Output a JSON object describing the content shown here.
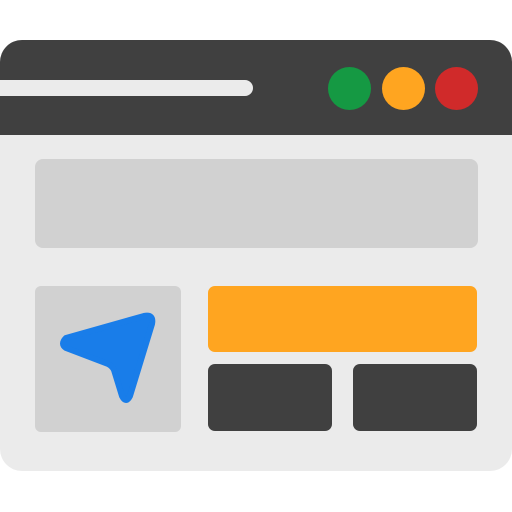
{
  "window": {
    "controls": [
      {
        "name": "green",
        "color": "#159943"
      },
      {
        "name": "orange",
        "color": "#ffa520"
      },
      {
        "name": "red",
        "color": "#d02a2a"
      }
    ]
  },
  "icons": {
    "cursor": "navigation-arrow-icon"
  },
  "colors": {
    "titlebar": "#404040",
    "body": "#ebebeb",
    "placeholder": "#d1d1d1",
    "accent": "#ffa520",
    "cursor": "#197de9",
    "block": "#404040"
  }
}
